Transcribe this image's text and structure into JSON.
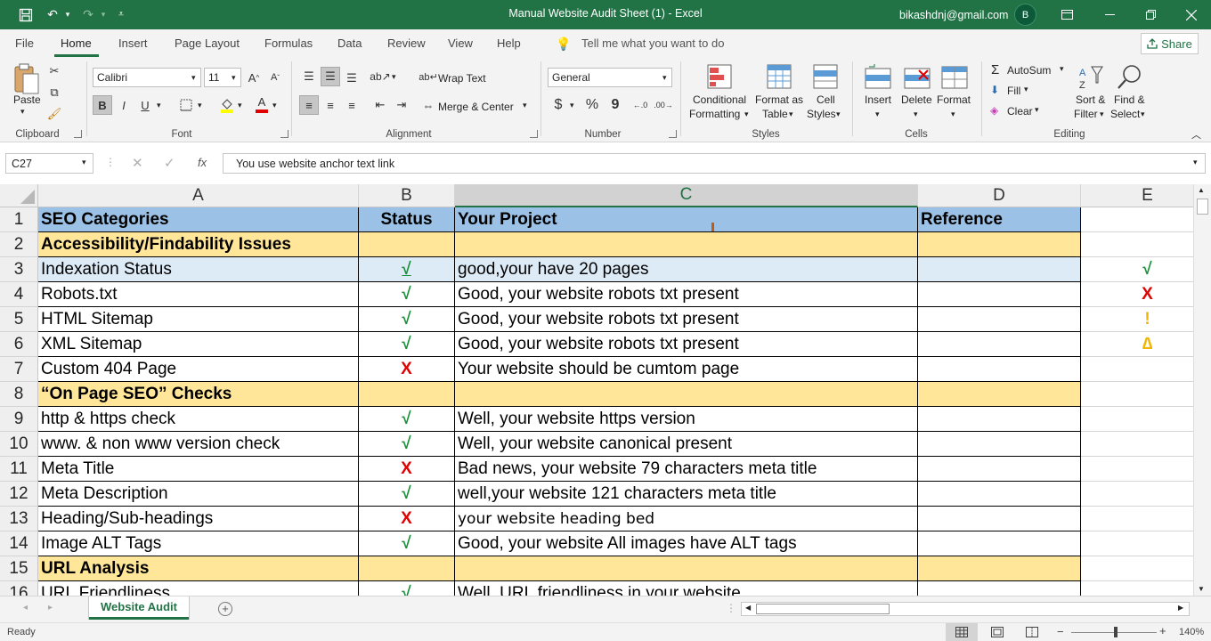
{
  "window": {
    "title": "Manual Website Audit Sheet (1)  -  Excel",
    "account_email": "bikashdnj@gmail.com",
    "avatar_initial": "B",
    "accent": "#217346"
  },
  "menu": {
    "tabs": [
      "File",
      "Home",
      "Insert",
      "Page Layout",
      "Formulas",
      "Data",
      "Review",
      "View",
      "Help"
    ],
    "active": "Home",
    "tell_me": "Tell me what you want to do",
    "share": "Share"
  },
  "ribbon": {
    "clipboard": {
      "label": "Clipboard",
      "paste": "Paste"
    },
    "font": {
      "label": "Font",
      "font_name": "Calibri",
      "font_size": "11",
      "bold": "B",
      "italic": "I",
      "underline": "U"
    },
    "alignment": {
      "label": "Alignment",
      "wrap_text": "Wrap Text",
      "merge_center": "Merge & Center"
    },
    "number": {
      "label": "Number",
      "format": "General",
      "currency": "$",
      "percent": "%",
      "comma": "9"
    },
    "styles": {
      "label": "Styles",
      "conditional_1": "Conditional",
      "conditional_2": "Formatting",
      "format_table_1": "Format as",
      "format_table_2": "Table",
      "cell_styles_1": "Cell",
      "cell_styles_2": "Styles"
    },
    "cells": {
      "label": "Cells",
      "insert": "Insert",
      "delete": "Delete",
      "format": "Format"
    },
    "editing": {
      "label": "Editing",
      "autosum": "AutoSum",
      "fill": "Fill",
      "clear": "Clear",
      "sort_1": "Sort &",
      "sort_2": "Filter",
      "find_1": "Find &",
      "find_2": "Select"
    }
  },
  "formula_bar": {
    "name_box": "C27",
    "fx": "fx",
    "content": "You use website anchor text link"
  },
  "sheet": {
    "columns": [
      "A",
      "B",
      "C",
      "D",
      "E"
    ],
    "selected_column": "C",
    "rows": [
      {
        "n": "1",
        "a": "SEO Categories",
        "b": "Status",
        "c": "Your Project",
        "d": "Reference",
        "e": "",
        "type": "header"
      },
      {
        "n": "2",
        "a": "Accessibility/Findability Issues",
        "b": "",
        "c": "",
        "d": "",
        "e": "",
        "type": "category"
      },
      {
        "n": "3",
        "a": "Indexation Status",
        "b": "√",
        "c": "good,your have 20 pages",
        "d": "",
        "e": "√",
        "type": "highlight",
        "bk": "check",
        "ek": "check"
      },
      {
        "n": "4",
        "a": "Robots.txt",
        "b": "√",
        "c": "Good, your website robots txt present",
        "d": "",
        "e": "X",
        "bk": "check",
        "ek": "cross"
      },
      {
        "n": "5",
        "a": "HTML Sitemap",
        "b": "√",
        "c": "Good, your website robots txt present",
        "d": "",
        "e": "!",
        "bk": "check",
        "ek": "warn"
      },
      {
        "n": "6",
        "a": "XML Sitemap",
        "b": "√",
        "c": "Good, your website robots txt present",
        "d": "",
        "e": "∆",
        "bk": "check",
        "ek": "warn"
      },
      {
        "n": "7",
        "a": "Custom 404 Page",
        "b": "X",
        "c": "Your website should be cumtom page",
        "d": "",
        "e": "",
        "bk": "cross"
      },
      {
        "n": "8",
        "a": "“On Page  SEO” Checks",
        "b": "",
        "c": "",
        "d": "",
        "e": "",
        "type": "category"
      },
      {
        "n": "9",
        "a": "http & https check",
        "b": "√",
        "c": "Well, your website https version",
        "d": "",
        "e": "",
        "bk": "check"
      },
      {
        "n": "10",
        "a": "www. & non www version check",
        "b": "√",
        "c": "Well, your website canonical present",
        "d": "",
        "e": "",
        "bk": "check"
      },
      {
        "n": "11",
        "a": "Meta Title",
        "b": "X",
        "c": "Bad news, your website 79 characters meta title",
        "d": "",
        "e": "",
        "bk": "cross"
      },
      {
        "n": "12",
        "a": "Meta Description",
        "b": "√",
        "c": "well,your website 121 characters meta title",
        "d": "",
        "e": "",
        "bk": "check"
      },
      {
        "n": "13",
        "a": "Heading/Sub-headings",
        "b": "X",
        "c": "your website heading  bed",
        "d": "",
        "e": "",
        "bk": "cross"
      },
      {
        "n": "14",
        "a": "Image ALT Tags",
        "b": "√",
        "c": "Good, your website All images have ALT tags",
        "d": "",
        "e": "",
        "bk": "check"
      },
      {
        "n": "15",
        "a": "URL Analysis",
        "b": "",
        "c": "",
        "d": "",
        "e": "",
        "type": "category"
      },
      {
        "n": "16",
        "a": "URL Friendliness",
        "b": "√",
        "c": "Well, URL friendliness in your website",
        "d": "",
        "e": "",
        "bk": "check"
      }
    ]
  },
  "sheet_tabs": {
    "active": "Website Audit"
  },
  "status": {
    "text": "Ready",
    "zoom": "140%"
  }
}
